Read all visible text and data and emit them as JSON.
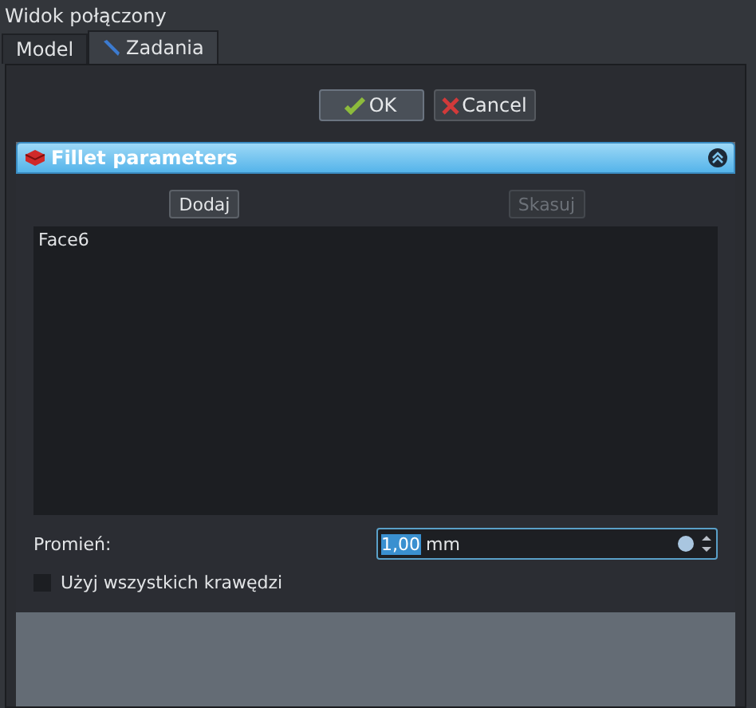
{
  "window": {
    "title": "Widok połączony"
  },
  "tabs": [
    {
      "label": "Model",
      "selected": false,
      "kind": "plain"
    },
    {
      "label": "Zadania",
      "selected": true,
      "kind": "task"
    }
  ],
  "dialog_buttons": [
    {
      "label": "OK",
      "kind": "ok"
    },
    {
      "label": "Cancel",
      "kind": "cancel"
    }
  ],
  "panel": {
    "title": "Fillet parameters",
    "expanded": true,
    "buttons": [
      {
        "label": "Dodaj",
        "disabled": false
      },
      {
        "label": "Skasuj",
        "disabled": true
      }
    ],
    "items": [
      {
        "label": "Face6",
        "selected": false
      }
    ],
    "radius": {
      "label": "Promień:",
      "value": "1,00",
      "unit": "mm"
    },
    "use_all_edges": {
      "label": "Użyj wszystkich krawędzi",
      "checked": false
    }
  }
}
